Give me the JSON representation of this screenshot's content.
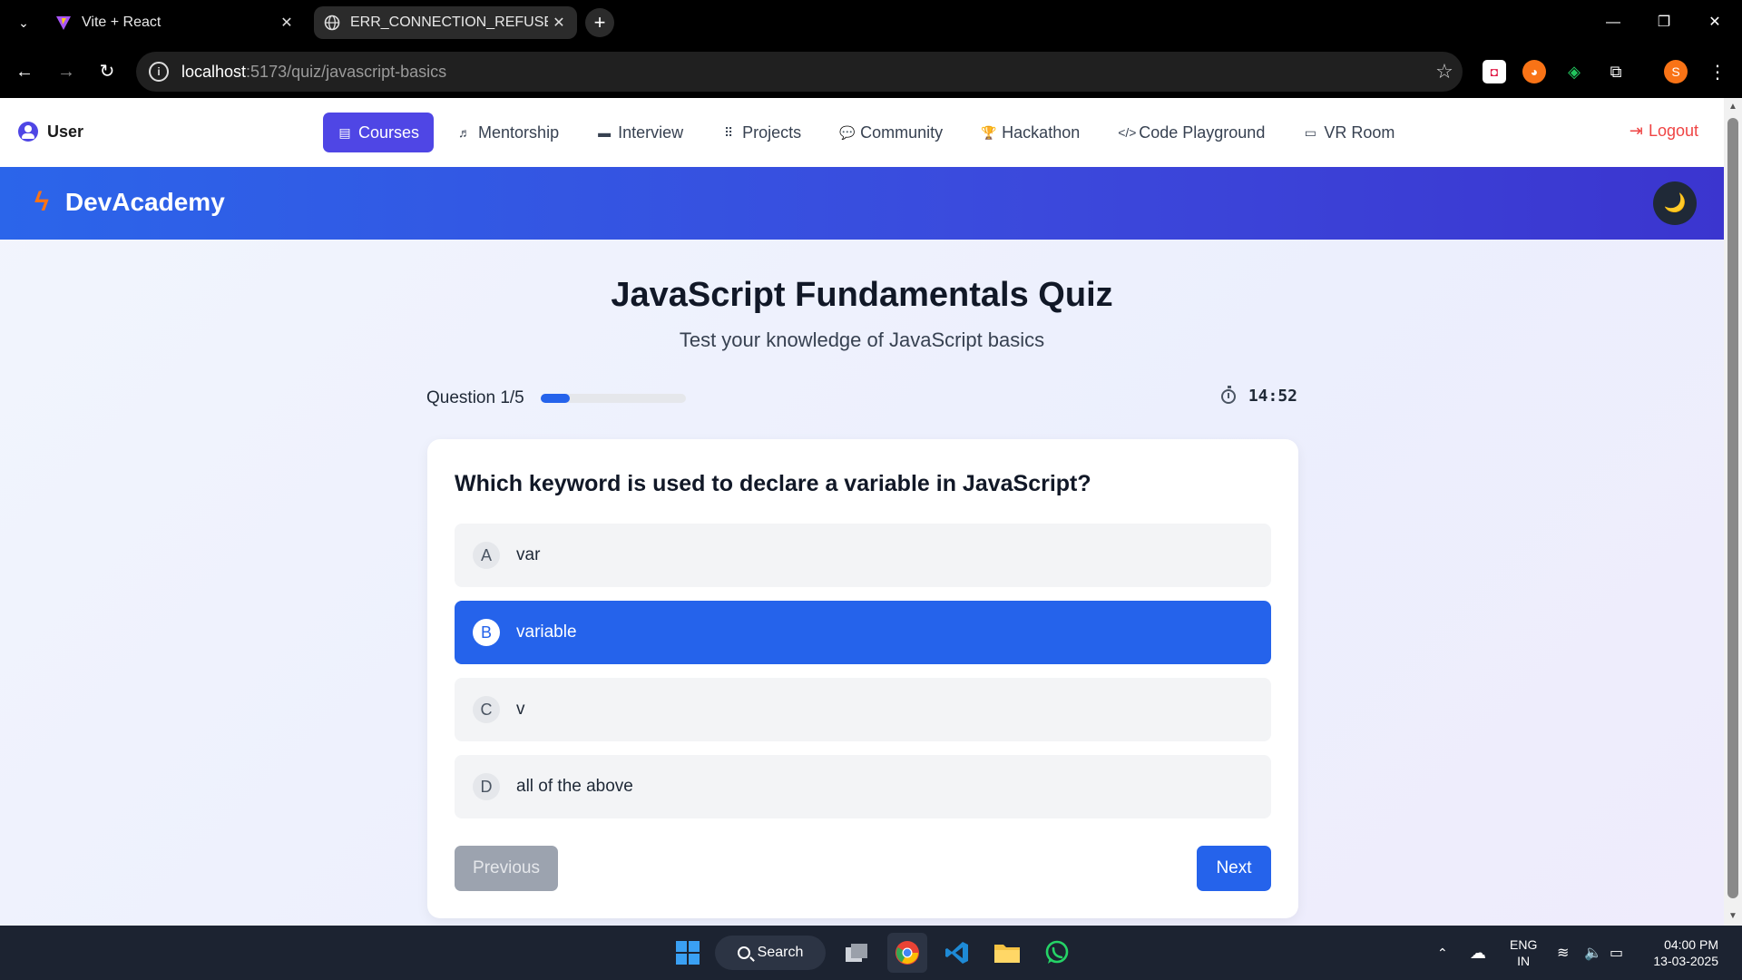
{
  "browser": {
    "tabs": [
      {
        "title": "Vite + React",
        "icon": "vite-icon"
      },
      {
        "title": "ERR_CONNECTION_REFUSED Tr",
        "icon": "globe-icon"
      }
    ],
    "url_host": "localhost",
    "url_path": ":5173/quiz/javascript-basics",
    "profile_initial": "S"
  },
  "topnav": {
    "user_label": "User",
    "links": [
      {
        "label": "Courses",
        "icon": "book-icon",
        "glyph": "▤"
      },
      {
        "label": "Mentorship",
        "icon": "chalkboard-icon",
        "glyph": "♬"
      },
      {
        "label": "Interview",
        "icon": "briefcase-icon",
        "glyph": "▬"
      },
      {
        "label": "Projects",
        "icon": "project-diagram-icon",
        "glyph": "⠿"
      },
      {
        "label": "Community",
        "icon": "comments-icon",
        "glyph": "💬"
      },
      {
        "label": "Hackathon",
        "icon": "trophy-icon",
        "glyph": "🏆"
      },
      {
        "label": "Code Playground",
        "icon": "code-icon",
        "glyph": "</>"
      },
      {
        "label": "VR Room",
        "icon": "vr-cardboard-icon",
        "glyph": "▭"
      }
    ],
    "logout_label": "Logout"
  },
  "brand": {
    "name": "DevAcademy",
    "theme_toggle": "🌙"
  },
  "quiz": {
    "title": "JavaScript Fundamentals Quiz",
    "subtitle": "Test your knowledge of JavaScript basics",
    "question_counter": "Question 1/5",
    "progress_fraction": 0.2,
    "timer": "14:52",
    "question": "Which keyword is used to declare a variable in JavaScript?",
    "options": [
      {
        "letter": "A",
        "text": "var"
      },
      {
        "letter": "B",
        "text": "variable"
      },
      {
        "letter": "C",
        "text": "v"
      },
      {
        "letter": "D",
        "text": "all of the above"
      }
    ],
    "selected_option": "B",
    "prev_label": "Previous",
    "next_label": "Next"
  },
  "taskbar": {
    "search_label": "Search",
    "lang_line1": "ENG",
    "lang_line2": "IN",
    "time": "04:00 PM",
    "date": "13-03-2025"
  },
  "colors": {
    "accent": "#2563eb",
    "nav_active": "#4f46e5",
    "logout": "#ef4444",
    "brand_bolt": "#f97316"
  }
}
